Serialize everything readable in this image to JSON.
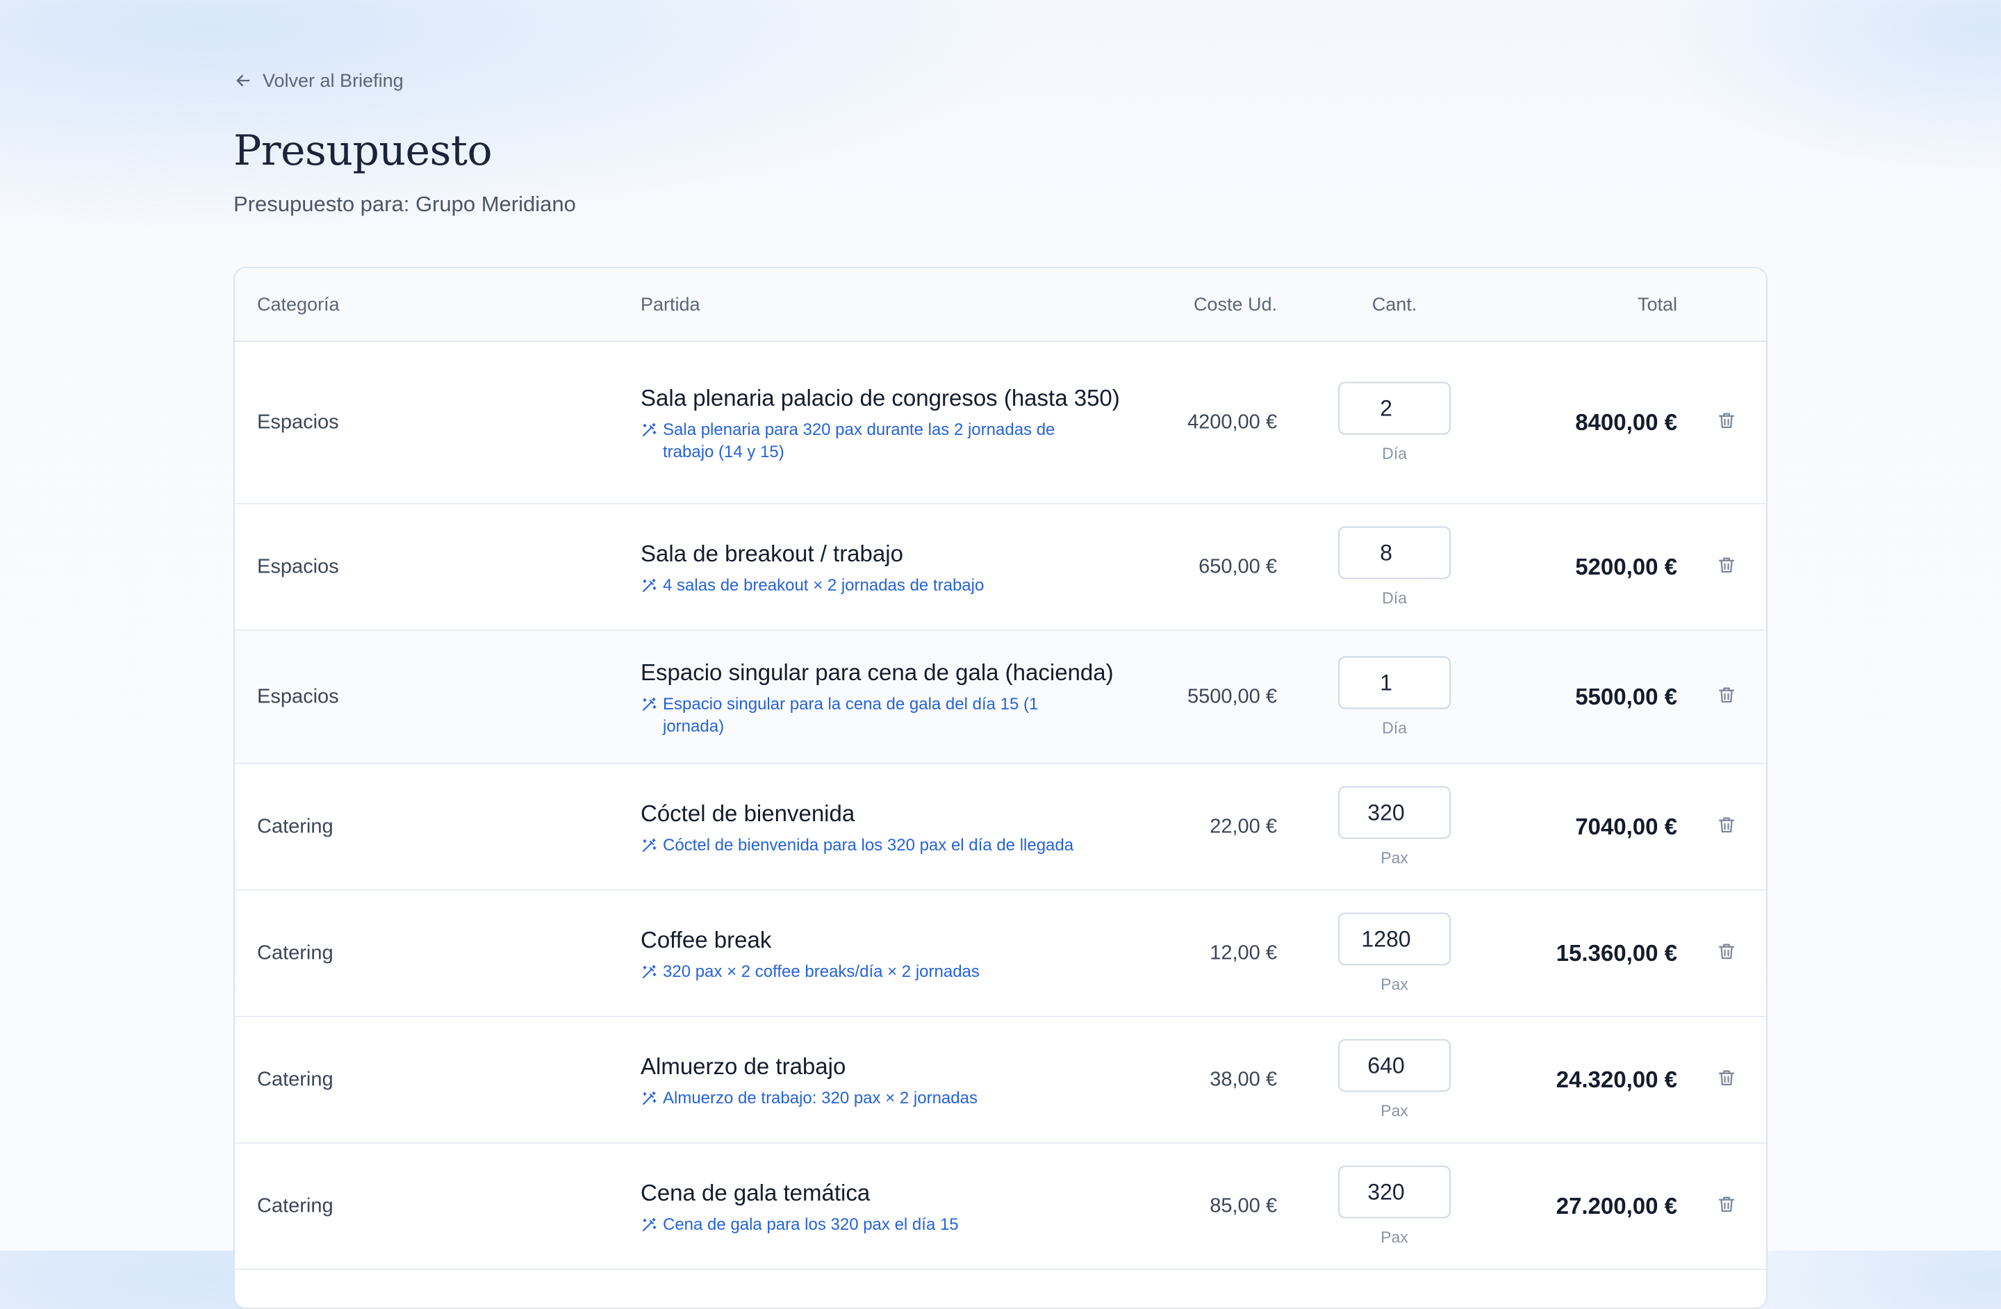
{
  "nav": {
    "back_label": "Volver al Briefing"
  },
  "header": {
    "title": "Presupuesto",
    "subtitle": "Presupuesto para: Grupo Meridiano"
  },
  "table": {
    "columns": {
      "category": "Categoría",
      "item": "Partida",
      "unit_cost": "Coste Ud.",
      "quantity": "Cant.",
      "total": "Total"
    },
    "rows": [
      {
        "category": "Espacios",
        "name": "Sala plenaria palacio de congresos (hasta 350)",
        "note": "Sala plenaria para 320 pax durante las 2 jornadas de trabajo (14 y 15)",
        "unit_cost": "4200,00 €",
        "quantity": "2",
        "unit": "Día",
        "total": "8400,00 €"
      },
      {
        "category": "Espacios",
        "name": "Sala de breakout / trabajo",
        "note": "4 salas de breakout × 2 jornadas de trabajo",
        "unit_cost": "650,00 €",
        "quantity": "8",
        "unit": "Día",
        "total": "5200,00 €"
      },
      {
        "category": "Espacios",
        "name": "Espacio singular para cena de gala (hacienda)",
        "note": "Espacio singular para la cena de gala del día 15 (1 jornada)",
        "unit_cost": "5500,00 €",
        "quantity": "1",
        "unit": "Día",
        "total": "5500,00 €"
      },
      {
        "category": "Catering",
        "name": "Cóctel de bienvenida",
        "note": "Cóctel de bienvenida para los 320 pax el día de llegada",
        "unit_cost": "22,00 €",
        "quantity": "320",
        "unit": "Pax",
        "total": "7040,00 €"
      },
      {
        "category": "Catering",
        "name": "Coffee break",
        "note": "320 pax × 2 coffee breaks/día × 2 jornadas",
        "unit_cost": "12,00 €",
        "quantity": "1280",
        "unit": "Pax",
        "total": "15.360,00 €"
      },
      {
        "category": "Catering",
        "name": "Almuerzo de trabajo",
        "note": "Almuerzo de trabajo: 320 pax × 2 jornadas",
        "unit_cost": "38,00 €",
        "quantity": "640",
        "unit": "Pax",
        "total": "24.320,00 €"
      },
      {
        "category": "Catering",
        "name": "Cena de gala temática",
        "note": "Cena de gala para los 320 pax el día 15",
        "unit_cost": "85,00 €",
        "quantity": "320",
        "unit": "Pax",
        "total": "27.200,00 €"
      }
    ]
  },
  "icons": {
    "back": "arrow-left-icon",
    "note": "magic-wand-icon",
    "delete": "trash-icon"
  },
  "colors": {
    "accent": "#2563d9",
    "title": "#1b2438",
    "border": "#dde4ee"
  }
}
